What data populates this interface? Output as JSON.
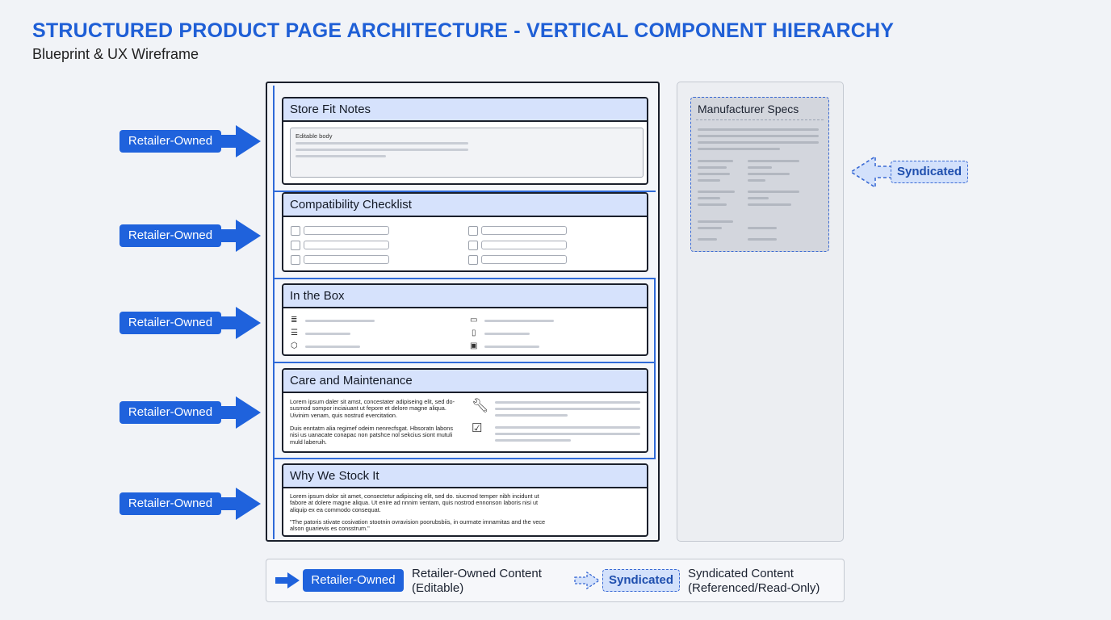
{
  "header": {
    "title": "STRUCTURED PRODUCT PAGE ARCHITECTURE - VERTICAL COMPONENT HIERARCHY",
    "subtitle": "Blueprint & UX Wireframe"
  },
  "labels": {
    "retailer": "Retailer-Owned",
    "syndicated": "Syndicated"
  },
  "sections": [
    {
      "title": "Store Fit Notes",
      "body_label": "Editable body"
    },
    {
      "title": "Compatibility Checklist"
    },
    {
      "title": "In the Box"
    },
    {
      "title": "Care and Maintenance",
      "para1": "Lorem ipsum daler sit amst, concestater adipiseing elit, sed do- susmod sompor inciaiuant ut fepore et delore magne aliqua. Uivinim venam, quis nostrud evercitation.",
      "para2": "Duis enntatm alia regimef odeim nenrecfsgat. Hbsoratn labons nisi us uanacate conapac non patshce nol sekcius siont mutuli muld laberuih."
    },
    {
      "title": "Why We Stock It",
      "para1": "Lorem ipsum dolor sit amet, consectetur adipiscing elit, sed do. siucmod temper nibh incidunt ut fabore at dolere magne aliqua. Ut enire ad nnnim ventam, quis nostrod ennonson laboris nisi ut aliquip ex ea commodo consequat.",
      "quote": "\"The patoris stivate cosivation stootnin ovravision poorubsbiis, in ourmate imnamitas and the vece alson guarievis es consstrum.\""
    }
  ],
  "specs": {
    "title": "Manufacturer Specs"
  },
  "legend": {
    "retailer_desc_1": "Retailer-Owned Content",
    "retailer_desc_2": "(Editable)",
    "synd_desc_1": "Syndicated Content",
    "synd_desc_2": "(Referenced/Read-Only)"
  },
  "colors": {
    "accent": "#1f62dc",
    "header_fill": "#d6e2fc",
    "syndicated_fill": "#d3e1fb"
  }
}
